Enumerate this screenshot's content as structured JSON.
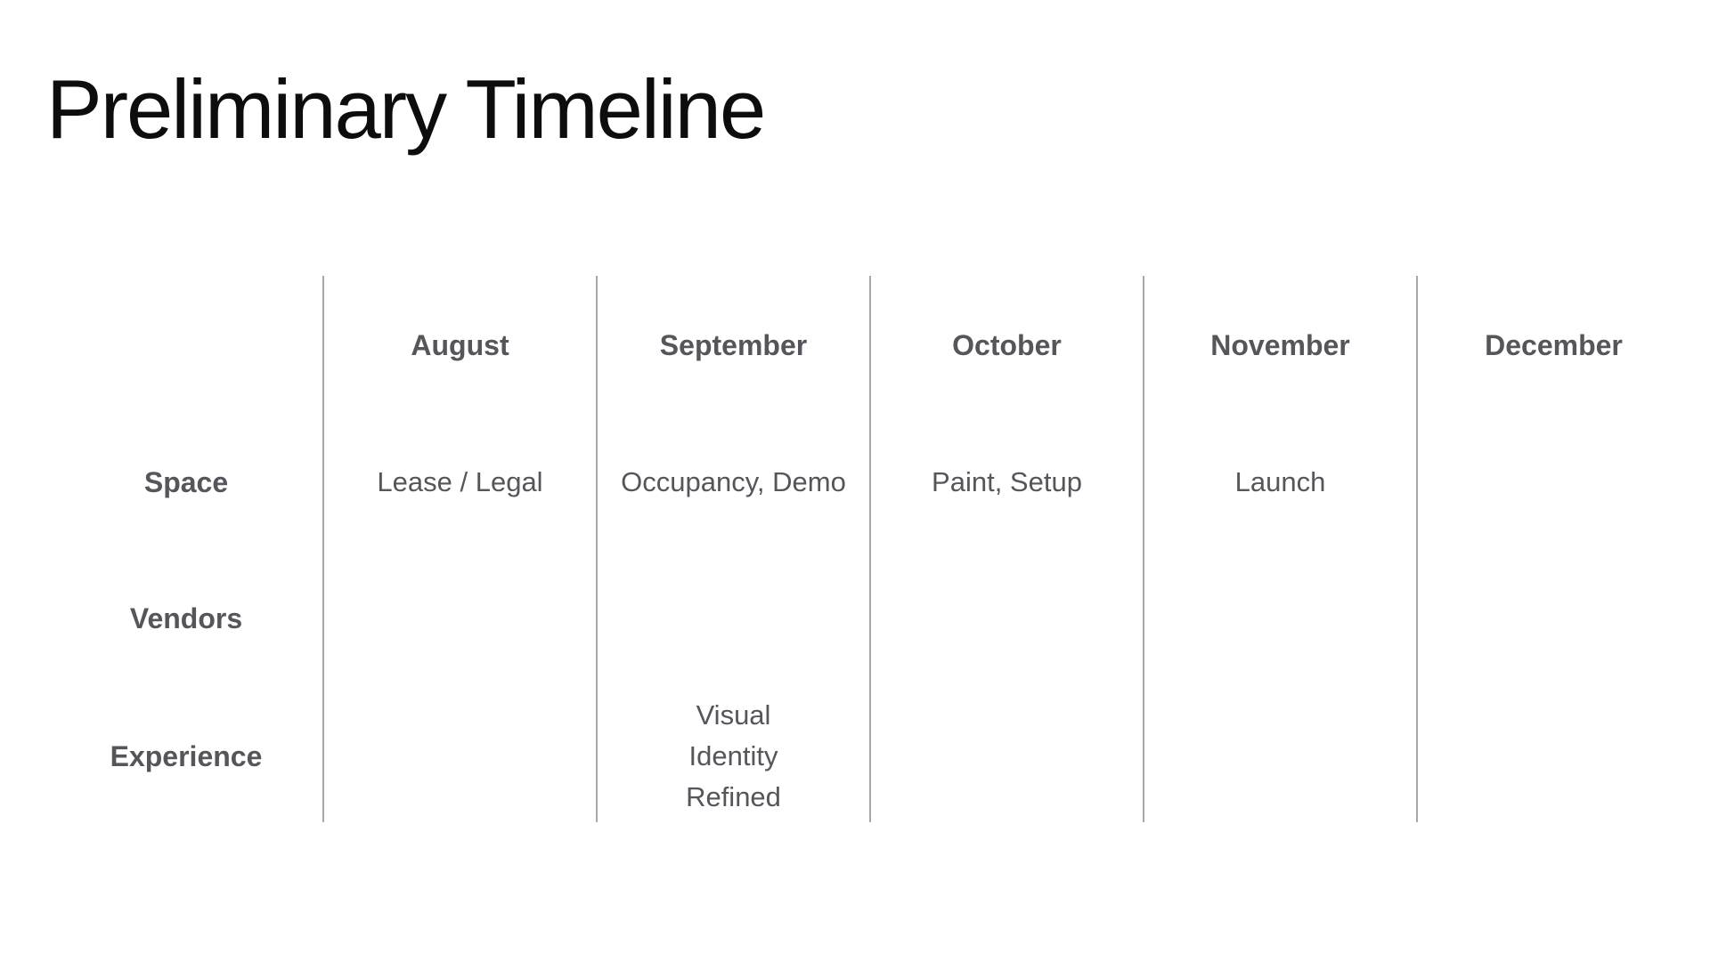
{
  "slide": {
    "title": "Preliminary Timeline"
  },
  "timeline": {
    "months": [
      "August",
      "September",
      "October",
      "November",
      "December"
    ],
    "rows": [
      {
        "label": "Space",
        "cells": [
          "Lease / Legal",
          "Occupancy, Demo",
          "Paint, Setup",
          "Launch",
          ""
        ]
      },
      {
        "label": "Vendors",
        "cells": [
          "",
          "",
          "",
          "",
          ""
        ]
      },
      {
        "label": "Experience",
        "cells": [
          "",
          "Visual Identity Refined",
          "",
          "",
          ""
        ]
      }
    ]
  },
  "colors": {
    "title": "#0d0d0d",
    "text": "#54565b",
    "divider": "#a7a8aa",
    "background": "#ffffff"
  }
}
